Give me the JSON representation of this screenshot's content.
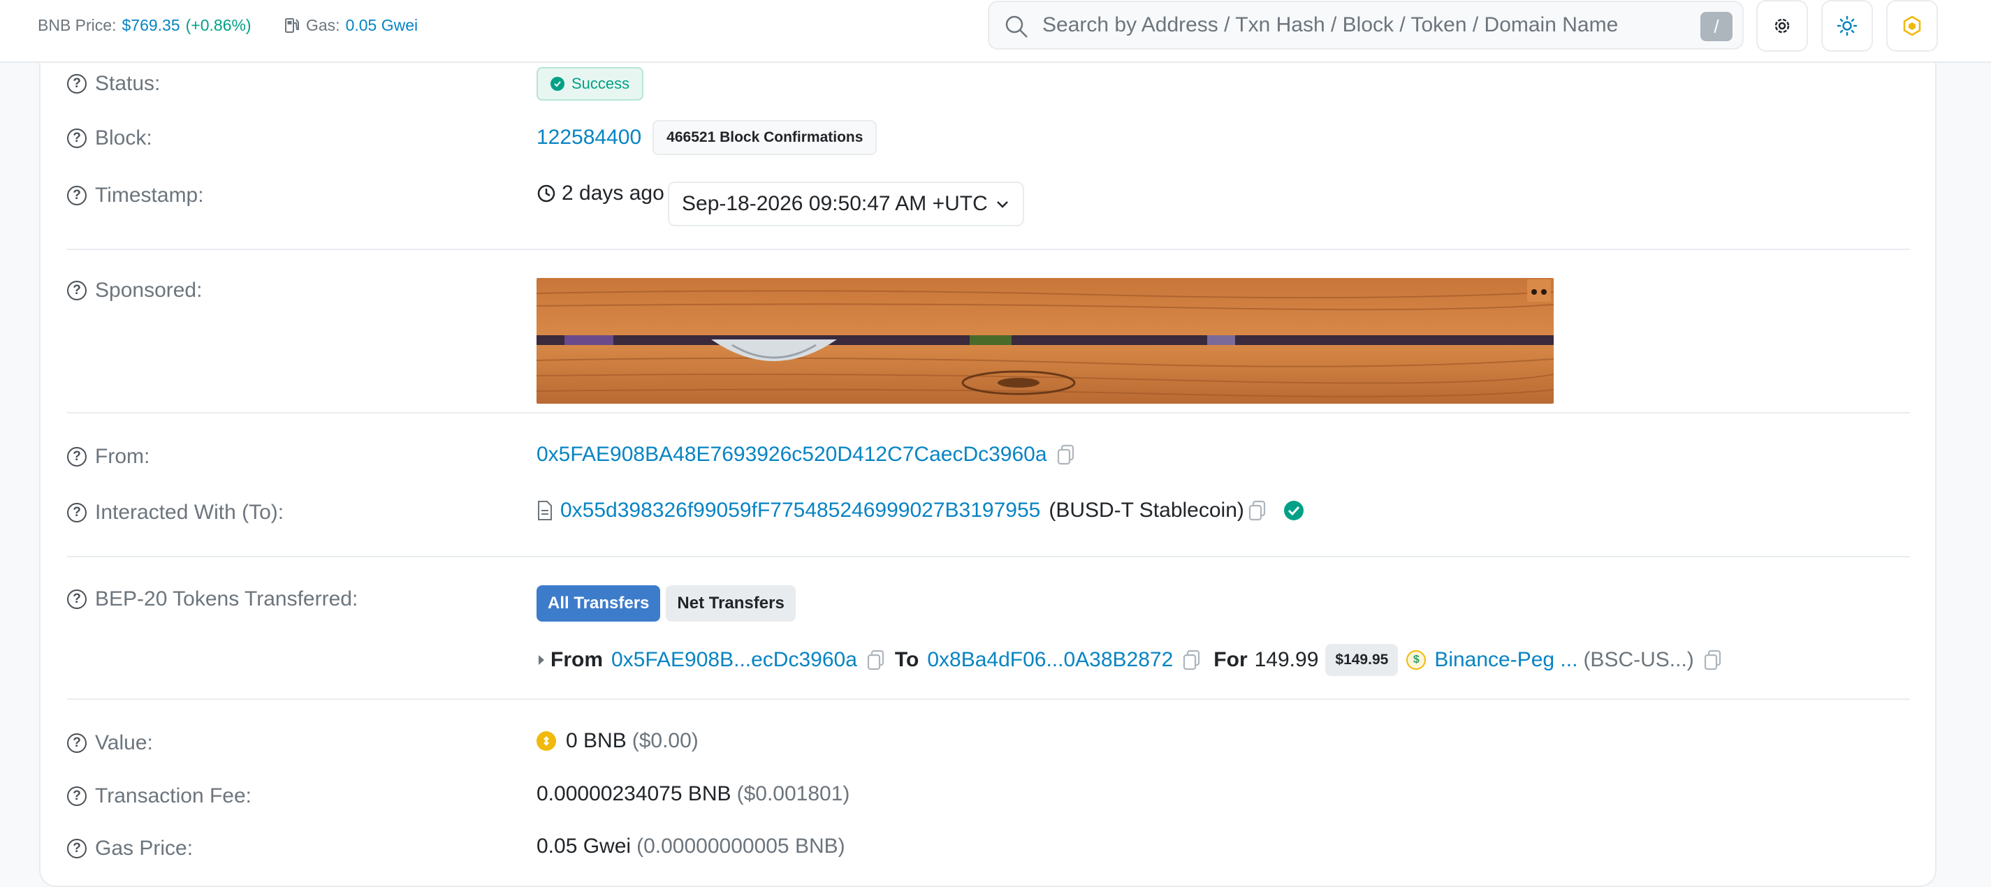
{
  "topbar": {
    "price_label": "BNB Price:",
    "price_value": "$769.35",
    "price_change": "(+0.86%)",
    "gas_label": "Gas:",
    "gas_value": "0.05 Gwei",
    "search_placeholder": "Search by Address / Txn Hash / Block / Token / Domain Name",
    "search_shortcut": "/"
  },
  "details": {
    "status": {
      "label": "Status:",
      "value": "Success"
    },
    "block": {
      "label": "Block:",
      "number": "122584400",
      "confirmations": "466521 Block Confirmations"
    },
    "timestamp": {
      "label": "Timestamp:",
      "ago": "2 days ago",
      "datetime": "Sep-18-2026 09:50:47 AM +UTC"
    },
    "sponsored": {
      "label": "Sponsored:"
    },
    "from": {
      "label": "From:",
      "address": "0x5FAE908BA48E7693926c520D412C7CaecDc3960a"
    },
    "to": {
      "label": "Interacted With (To):",
      "address": "0x55d398326f99059fF775485246999027B3197955",
      "name": "(BUSD-T Stablecoin)"
    },
    "tokens": {
      "label": "BEP-20 Tokens Transferred:",
      "tab_all": "All Transfers",
      "tab_net": "Net Transfers",
      "transfer": {
        "from_word": "From",
        "from_addr": "0x5FAE908B...ecDc3960a",
        "to_word": "To",
        "to_addr": "0x8Ba4dF06...0A38B2872",
        "for_word": "For",
        "amount": "149.99",
        "usd": "$149.95",
        "token_name": "Binance-Peg ...",
        "token_symbol": "(BSC-US...)"
      }
    },
    "value": {
      "label": "Value:",
      "amount": "0 BNB",
      "usd": "($0.00)"
    },
    "fee": {
      "label": "Transaction Fee:",
      "amount": "0.00000234075 BNB",
      "usd": "($0.001801)"
    },
    "gas_price": {
      "label": "Gas Price:",
      "amount": "0.05 Gwei",
      "bnb": "(0.00000000005 BNB)"
    }
  },
  "colors": {
    "link": "#0784c3",
    "success": "#00a186",
    "muted": "#6c757d",
    "bnb": "#f0b90b"
  },
  "icons": [
    "gas-pump-icon",
    "search-icon",
    "settings-gear-icon",
    "sun-icon",
    "bnb-logo-icon",
    "help-circle-icon",
    "check-circle-icon",
    "clock-icon",
    "chevron-down-icon",
    "copy-icon",
    "contract-file-icon",
    "verified-check-icon",
    "caret-right-icon",
    "usd-token-icon",
    "bnb-coin-icon"
  ]
}
